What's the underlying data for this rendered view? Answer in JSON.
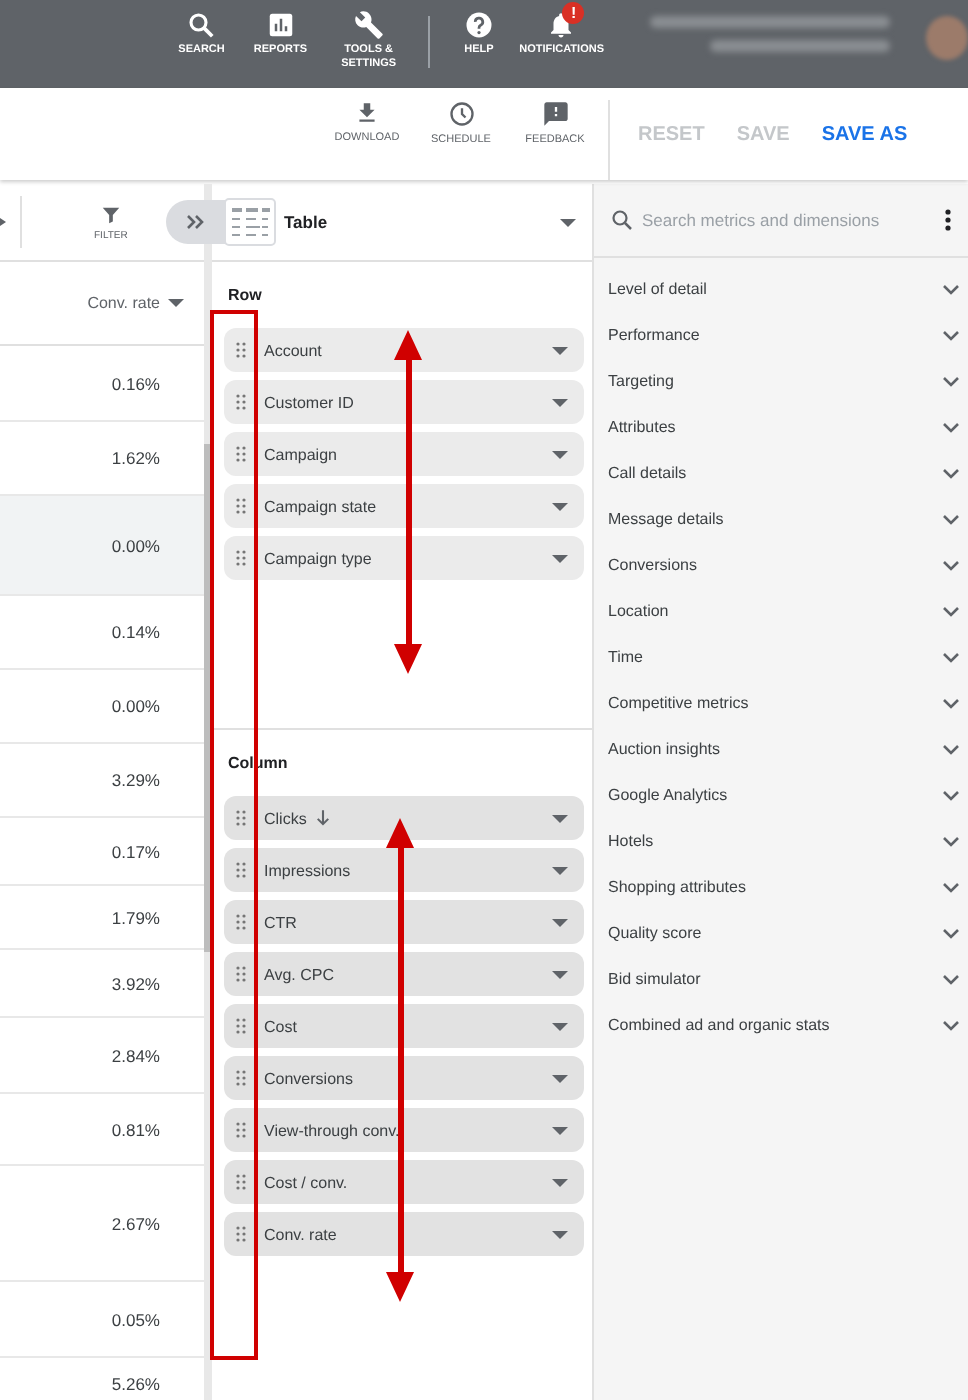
{
  "top_bar": {
    "items": [
      {
        "kind": "search",
        "label": "SEARCH"
      },
      {
        "kind": "reports",
        "label": "REPORTS"
      },
      {
        "kind": "tools",
        "label": "TOOLS & SETTINGS"
      },
      {
        "kind": "help",
        "label": "HELP"
      },
      {
        "kind": "notifications",
        "label": "NOTIFICATIONS",
        "badge": "!"
      }
    ]
  },
  "toolbar": {
    "tools": [
      {
        "kind": "download",
        "label": "DOWNLOAD"
      },
      {
        "kind": "schedule",
        "label": "SCHEDULE"
      },
      {
        "kind": "feedback",
        "label": "FEEDBACK"
      }
    ],
    "actions": [
      {
        "label": "RESET",
        "disabled": true
      },
      {
        "label": "SAVE",
        "disabled": true
      },
      {
        "label": "SAVE AS",
        "disabled": false
      }
    ]
  },
  "table": {
    "filter_label": "FILTER",
    "column": "Conv. rate",
    "rows": [
      {
        "value": "0.16%",
        "selected": false
      },
      {
        "value": "1.62%",
        "selected": false
      },
      {
        "value": "0.00%",
        "selected": true
      },
      {
        "value": "0.14%",
        "selected": false
      },
      {
        "value": "0.00%",
        "selected": false
      },
      {
        "value": "3.29%",
        "selected": false
      },
      {
        "value": "0.17%",
        "selected": false
      },
      {
        "value": "1.79%",
        "selected": false
      },
      {
        "value": "3.92%",
        "selected": false
      },
      {
        "value": "2.84%",
        "selected": false
      },
      {
        "value": "0.81%",
        "selected": false
      },
      {
        "value": "2.67%",
        "selected": false
      },
      {
        "value": "0.05%",
        "selected": false
      },
      {
        "value": "5.26%",
        "selected": false
      }
    ]
  },
  "editor": {
    "chart_type": "Table",
    "row_title": "Row",
    "rows": [
      {
        "label": "Account",
        "sorted": false
      },
      {
        "label": "Customer ID",
        "sorted": false
      },
      {
        "label": "Campaign",
        "sorted": false
      },
      {
        "label": "Campaign state",
        "sorted": false
      },
      {
        "label": "Campaign type",
        "sorted": false
      }
    ],
    "column_title": "Column",
    "columns": [
      {
        "label": "Clicks",
        "sorted": true
      },
      {
        "label": "Impressions",
        "sorted": false
      },
      {
        "label": "CTR",
        "sorted": false
      },
      {
        "label": "Avg. CPC",
        "sorted": false
      },
      {
        "label": "Cost",
        "sorted": false
      },
      {
        "label": "Conversions",
        "sorted": false
      },
      {
        "label": "View-through conv.",
        "sorted": false
      },
      {
        "label": "Cost / conv.",
        "sorted": false
      },
      {
        "label": "Conv. rate",
        "sorted": false
      }
    ]
  },
  "catalog": {
    "search": {
      "placeholder": "Search metrics and dimensions"
    },
    "groups": [
      "Level of detail",
      "Performance",
      "Targeting",
      "Attributes",
      "Call details",
      "Message details",
      "Conversions",
      "Location",
      "Time",
      "Competitive metrics",
      "Auction insights",
      "Google Analytics",
      "Hotels",
      "Shopping attributes",
      "Quality score",
      "Bid simulator",
      "Combined ad and organic stats"
    ]
  }
}
